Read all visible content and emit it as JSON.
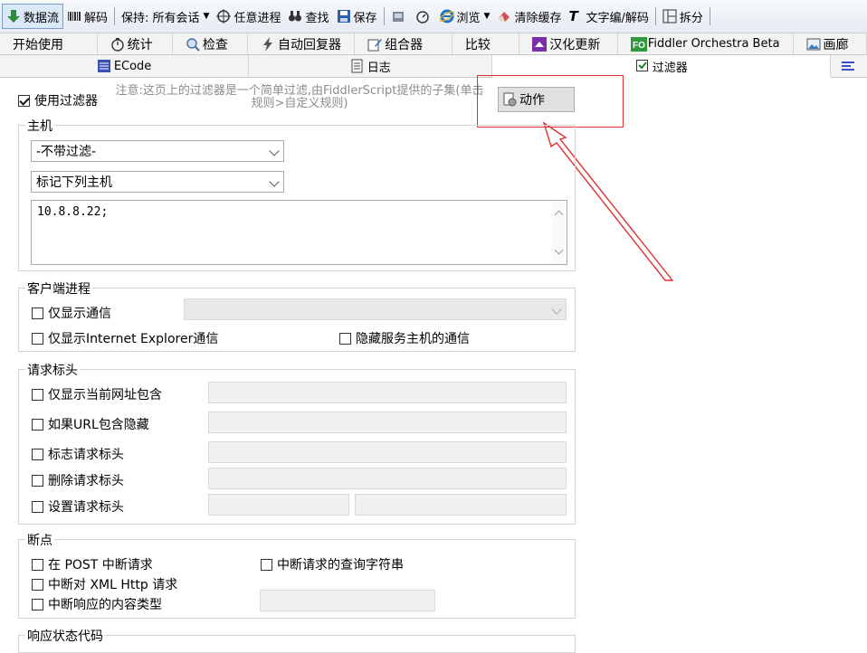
{
  "toolbar": {
    "stream": "数据流",
    "decode": "解码",
    "keep": "保持: 所有会话",
    "any_process": "任意进程",
    "find": "查找",
    "save": "保存",
    "browse": "浏览",
    "clear_cache": "清除缓存",
    "text_wizard": "文字编/解码",
    "split": "拆分"
  },
  "tabs_row1": [
    "开始使用",
    "统计",
    "检查",
    "自动回复器",
    "组合器",
    "比较",
    "汉化更新",
    "Fiddler Orchestra Beta",
    "画廊"
  ],
  "tabs_row2": [
    "ECode",
    "日志",
    "过滤器"
  ],
  "filters": {
    "use_filters": "使用过滤器",
    "note": "注意:这页上的过滤器是一个简单过滤,由FiddlerScript提供的子集(单击规则>自定义规则)",
    "actions_button": "动作",
    "hosts": {
      "title": "主机",
      "zone_select": "-不带过滤-",
      "host_mode_select": "标记下列主机",
      "host_list": "10.8.8.22;"
    },
    "client_process": {
      "title": "客户端进程",
      "show_only": "仅显示通信",
      "show_ie_only": "仅显示Internet Explorer通信",
      "hide_service_hosts": "隐藏服务主机的通信"
    },
    "request_headers": {
      "title": "请求标头",
      "items": [
        "仅显示当前网址包含",
        "如果URL包含隐藏",
        "标志请求标头",
        "删除请求标头",
        "设置请求标头"
      ]
    },
    "breakpoints": {
      "title": "断点",
      "break_post": "在 POST 中断请求",
      "break_query": "中断请求的查询字符串",
      "break_xml": "中断对 XML Http 请求",
      "break_content_type": "中断响应的内容类型"
    },
    "response_status": {
      "title": "响应状态代码"
    }
  },
  "colors": {
    "annotation": "#e03030",
    "toolbar_green": "#2e8b3d",
    "tab_accent": "#7b2ea8"
  },
  "icons": [
    "down-arrow-icon",
    "barcode-icon",
    "crosshair-icon",
    "binoculars-icon",
    "save-icon",
    "camera-icon",
    "timer-icon",
    "ie-icon",
    "eraser-icon",
    "text-t-icon",
    "split-icon",
    "stopwatch-icon",
    "magnifier-icon",
    "lightning-icon",
    "composer-icon",
    "update-icon",
    "fo-icon",
    "gallery-icon",
    "ecode-icon",
    "log-icon",
    "checkbox-icon",
    "list-icon",
    "script-icon"
  ]
}
